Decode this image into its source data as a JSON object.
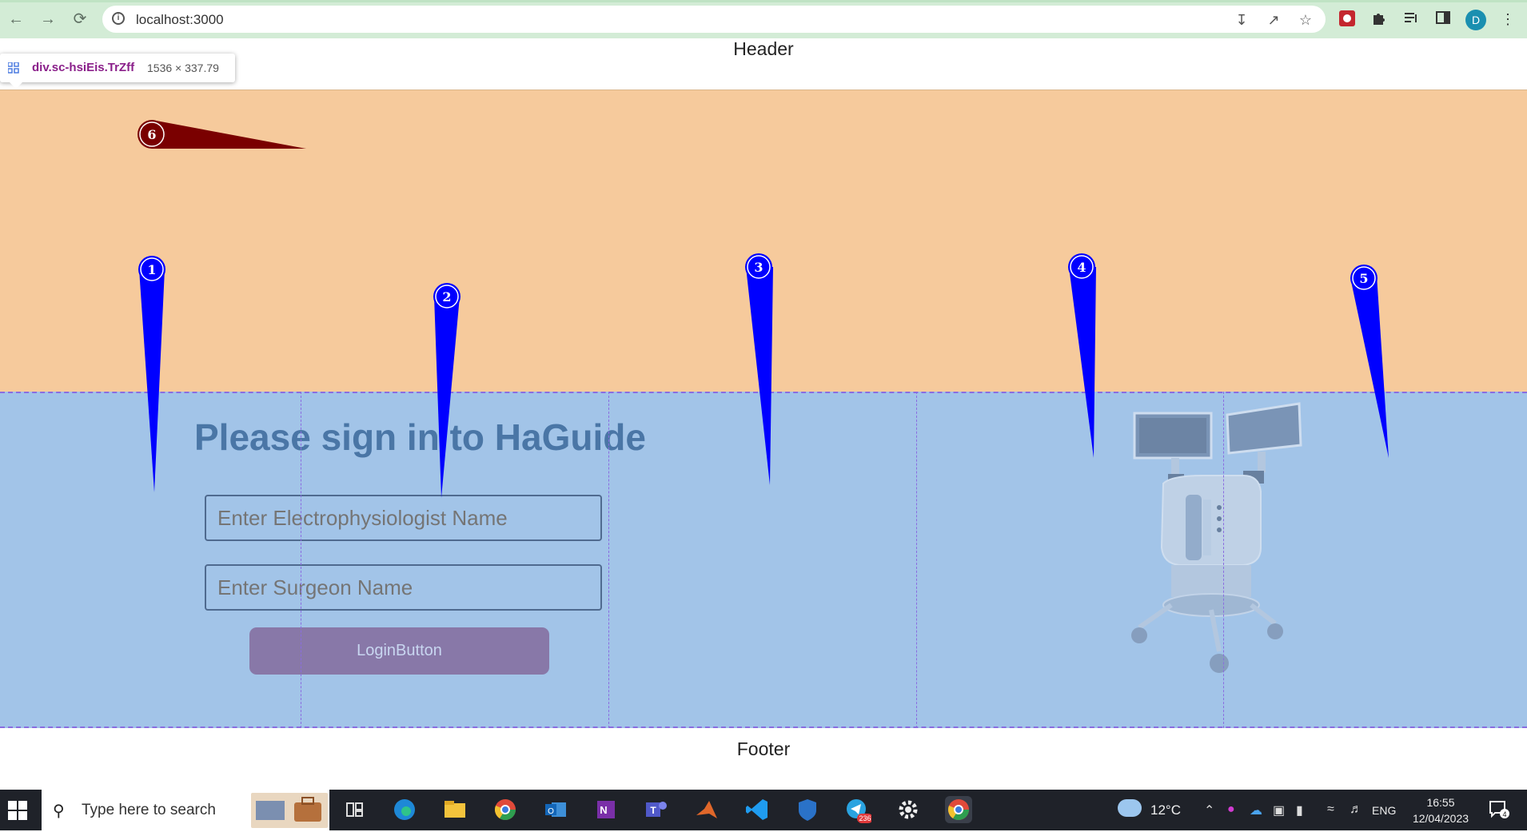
{
  "browser": {
    "url": "localhost:3000",
    "profile_initial": "D"
  },
  "devtools_tooltip": {
    "selector": "div.sc-hsiEis.TrZff",
    "dimensions": "1536 × 337.79"
  },
  "page": {
    "header": "Header",
    "footer": "Footer",
    "sign_in": {
      "title": "Please sign in to HaGuide",
      "electrophysiologist_placeholder": "Enter Electrophysiologist Name",
      "surgeon_placeholder": "Enter Surgeon Name",
      "login_label": "LoginButton"
    },
    "markers": [
      {
        "label": "1",
        "color": "#0000ff"
      },
      {
        "label": "2",
        "color": "#0000ff"
      },
      {
        "label": "3",
        "color": "#0000ff"
      },
      {
        "label": "4",
        "color": "#0000ff"
      },
      {
        "label": "5",
        "color": "#0000ff"
      },
      {
        "label": "6",
        "color": "#7a0000"
      }
    ],
    "colors": {
      "map_area": "#f6ca9c",
      "sign_area": "#a2c4e8"
    }
  },
  "taskbar": {
    "search_placeholder": "Type here to search",
    "weather": "12°C",
    "language": "ENG",
    "time": "16:55",
    "date": "12/04/2023",
    "telegram_badge": "236",
    "notification_count": "4",
    "apps": [
      "task-view-icon",
      "edge-icon",
      "file-explorer-icon",
      "chrome-icon",
      "outlook-icon",
      "onenote-icon",
      "teams-icon",
      "matlab-icon",
      "vscode-icon",
      "defender-icon",
      "telegram-icon",
      "settings-icon",
      "chrome-active-icon"
    ]
  }
}
